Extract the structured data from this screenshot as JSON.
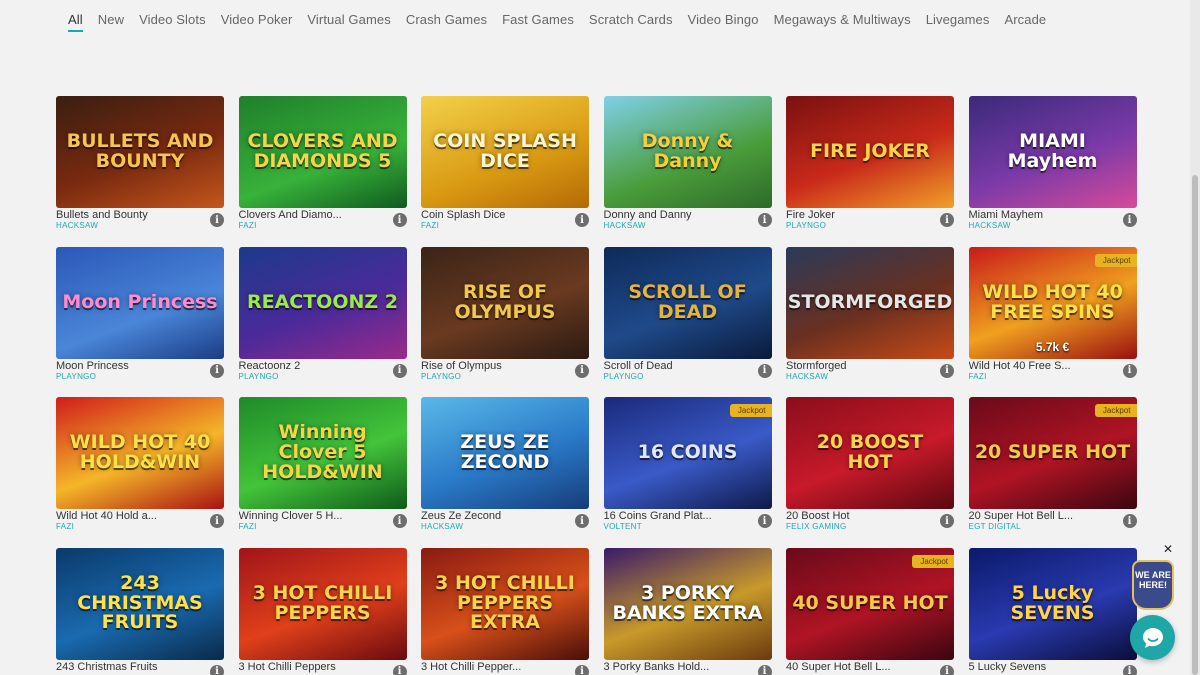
{
  "tabs": [
    {
      "label": "All",
      "active": true
    },
    {
      "label": "New"
    },
    {
      "label": "Video Slots"
    },
    {
      "label": "Video Poker"
    },
    {
      "label": "Virtual Games"
    },
    {
      "label": "Crash Games"
    },
    {
      "label": "Fast Games"
    },
    {
      "label": "Scratch Cards"
    },
    {
      "label": "Video Bingo"
    },
    {
      "label": "Megaways & Multiways"
    },
    {
      "label": "Livegames"
    },
    {
      "label": "Arcade"
    }
  ],
  "info_label": "i",
  "games": [
    {
      "name": "Bullets and Bounty",
      "provider": "HACKSAW",
      "art": "BULLETS AND BOUNTY",
      "bg": "linear-gradient(160deg,#3a1e12 0%,#7a2a10 55%,#c4561c 100%)",
      "fg": "#f7c451"
    },
    {
      "name": "Clovers And Diamo...",
      "provider": "FAZI",
      "art": "CLOVERS AND DIAMONDS 5",
      "bg": "linear-gradient(160deg,#1f7f2b 0%,#38b23a 60%,#0f5a1f 100%)",
      "fg": "#f5d64a"
    },
    {
      "name": "Coin Splash Dice",
      "provider": "FAZI",
      "art": "COIN SPLASH DICE",
      "bg": "linear-gradient(160deg,#f3d04a 0%,#d99a12 60%,#b36a06 100%)",
      "fg": "#fff6d0"
    },
    {
      "name": "Donny and Danny",
      "provider": "HACKSAW",
      "art": "Donny & Danny",
      "bg": "linear-gradient(160deg,#7fd0e8 0%,#4a9c3a 60%,#2d6a2a 100%)",
      "fg": "#f4d13c"
    },
    {
      "name": "Fire Joker",
      "provider": "PLAYNGO",
      "art": "FIRE JOKER",
      "bg": "linear-gradient(160deg,#7a1010 0%,#c92a1a 55%,#f0a02a 100%)",
      "fg": "#ffd34a"
    },
    {
      "name": "Miami Mayhem",
      "provider": "HACKSAW",
      "art": "MIAMI Mayhem",
      "bg": "linear-gradient(160deg,#3a2a7a 0%,#7a3aa8 55%,#d64a9a 100%)",
      "fg": "#ffffff"
    },
    {
      "name": "Moon Princess",
      "provider": "PLAYNGO",
      "art": "Moon Princess",
      "bg": "linear-gradient(160deg,#2b58b8 0%,#4a86d8 60%,#1b3c86 100%)",
      "fg": "#ff8ad0"
    },
    {
      "name": "Reactoonz 2",
      "provider": "PLAYNGO",
      "art": "REACTOONZ 2",
      "bg": "linear-gradient(160deg,#1c3a8a 0%,#4b2a9a 55%,#9a2a8a 100%)",
      "fg": "#9de84a"
    },
    {
      "name": "Rise of Olympus",
      "provider": "PLAYNGO",
      "art": "RISE OF OLYMPUS",
      "bg": "linear-gradient(160deg,#3a2418 0%,#6a3a20 55%,#2a1a12 100%)",
      "fg": "#f1c84a"
    },
    {
      "name": "Scroll of Dead",
      "provider": "PLAYNGO",
      "art": "SCROLL OF DEAD",
      "bg": "linear-gradient(160deg,#0e2a5a 0%,#1f4a8a 55%,#0a1a3a 100%)",
      "fg": "#e8b33a"
    },
    {
      "name": "Stormforged",
      "provider": "HACKSAW",
      "art": "STORMFORGED",
      "bg": "linear-gradient(160deg,#2a3a5a 0%,#6a3020 55%,#c84a18 100%)",
      "fg": "#e6e6e6"
    },
    {
      "name": "Wild Hot 40 Free S...",
      "provider": "FAZI",
      "art": "WILD HOT 40 FREE SPINS",
      "bg": "linear-gradient(160deg,#c81a1a 0%,#f0a020 55%,#9a1010 100%)",
      "fg": "#ffe04a",
      "jackpot": "Jackpot",
      "jackpot_value": "5.7k €"
    },
    {
      "name": "Wild Hot 40 Hold a...",
      "provider": "FAZI",
      "art": "WILD HOT 40 HOLD&WIN",
      "bg": "linear-gradient(160deg,#d01c1c 0%,#f5b628 55%,#a81212 100%)",
      "fg": "#ffe04a"
    },
    {
      "name": "Winning Clover 5 H...",
      "provider": "FAZI",
      "art": "Winning Clover 5 HOLD&WIN",
      "bg": "linear-gradient(160deg,#1f8a2a 0%,#43c43a 55%,#0e5a1a 100%)",
      "fg": "#f5d64a"
    },
    {
      "name": "Zeus Ze Zecond",
      "provider": "HACKSAW",
      "art": "ZEUS ZE ZECOND",
      "bg": "linear-gradient(160deg,#5ab8e8 0%,#2a7ac8 55%,#163c7a 100%)",
      "fg": "#ffffff"
    },
    {
      "name": "16 Coins Grand Plat...",
      "provider": "VOLTENT",
      "art": "16 COINS",
      "bg": "linear-gradient(160deg,#1a2a7a 0%,#3a5ac8 55%,#0e1a4a 100%)",
      "fg": "#dfe8ff",
      "jackpot": "Jackpot"
    },
    {
      "name": "20 Boost Hot",
      "provider": "FELIX GAMING",
      "art": "20 BOOST HOT",
      "bg": "linear-gradient(160deg,#8a0e1a 0%,#c81a2a 55%,#5a0810 100%)",
      "fg": "#ffd34a"
    },
    {
      "name": "20 Super Hot Bell L...",
      "provider": "EGT DIGITAL",
      "art": "20 SUPER HOT",
      "bg": "linear-gradient(160deg,#6a0a1a 0%,#b01424 55%,#3a0610 100%)",
      "fg": "#f5c84a",
      "jackpot": "Jackpot"
    },
    {
      "name": "243 Christmas Fruits",
      "provider": "",
      "art": "243 CHRISTMAS FRUITS",
      "bg": "linear-gradient(160deg,#0a3a6a 0%,#1a6ab0 55%,#0a2a4a 100%)",
      "fg": "#ffe24a"
    },
    {
      "name": "3 Hot Chilli Peppers",
      "provider": "",
      "art": "3 HOT CHILLI PEPPERS",
      "bg": "linear-gradient(160deg,#a0141a 0%,#e0401a 55%,#6a0a10 100%)",
      "fg": "#ffd34a"
    },
    {
      "name": "3 Hot Chilli Pepper...",
      "provider": "",
      "art": "3 HOT CHILLI PEPPERS EXTRA",
      "bg": "linear-gradient(160deg,#8a1a12 0%,#d8501a 55%,#4a0e0a 100%)",
      "fg": "#ffd34a"
    },
    {
      "name": "3 Porky Banks Hold...",
      "provider": "",
      "art": "3 PORKY BANKS EXTRA",
      "bg": "linear-gradient(160deg,#3a1a6a 0%,#c89a2a 55%,#6a3a0e 100%)",
      "fg": "#ffffff"
    },
    {
      "name": "40 Super Hot Bell L...",
      "provider": "",
      "art": "40 SUPER HOT",
      "bg": "linear-gradient(160deg,#6a0a1a 0%,#b01424 55%,#3a0610 100%)",
      "fg": "#f5c84a",
      "jackpot": "Jackpot"
    },
    {
      "name": "5 Lucky Sevens",
      "provider": "",
      "art": "5 Lucky SEVENS",
      "bg": "linear-gradient(160deg,#0a1a6a 0%,#2a3ab0 55%,#0a0e3a 100%)",
      "fg": "#ffd34a"
    }
  ],
  "widget": {
    "here_text": "WE ARE HERE!",
    "close": "✕"
  }
}
